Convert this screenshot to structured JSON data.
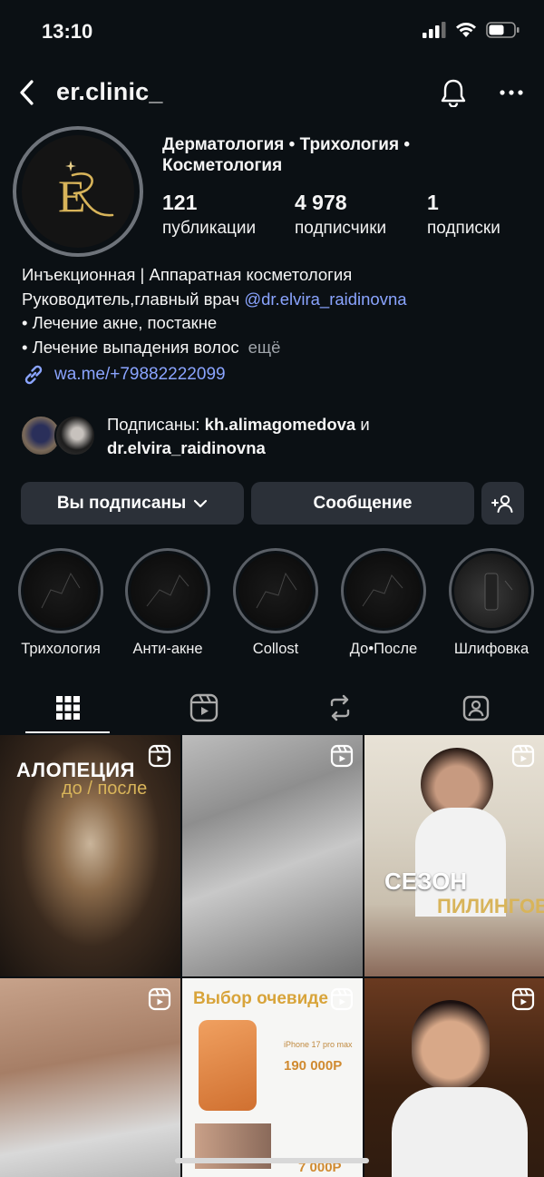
{
  "status_bar": {
    "time": "13:10"
  },
  "header": {
    "username": "er.clinic_"
  },
  "profile": {
    "category": "Дерматология • Трихология • Косметология",
    "stats": [
      {
        "value": "121",
        "label": "публикации"
      },
      {
        "value": "4 978",
        "label": "подписчики"
      },
      {
        "value": "1",
        "label": "подписки"
      }
    ],
    "bio": {
      "line1": "Инъекционная | Аппаратная косметология",
      "line2_prefix": "Руководитель,главный врач ",
      "line2_mention": "@dr.elvira_raidinovna",
      "line3": "• Лечение акне, постакне",
      "line4": "• Лечение выпадения волос",
      "more": "ещё"
    },
    "link": "wa.me/+79882222099",
    "followed_by": {
      "prefix": "Подписаны: ",
      "user1": "kh.alimagomedova",
      "conj": " и",
      "user2": "dr.elvira_raidinovna"
    }
  },
  "actions": {
    "following": "Вы подписаны",
    "message": "Сообщение"
  },
  "highlights": [
    {
      "label": "Трихология"
    },
    {
      "label": "Анти-акне"
    },
    {
      "label": "Collost"
    },
    {
      "label": "До•После"
    },
    {
      "label": "Шлифовка"
    }
  ],
  "posts": {
    "tile1_title": "АЛОПЕЦИЯ",
    "tile1_subtitle": "до / после",
    "tile3_title": "СЕЗОН",
    "tile3_subtitle": "ПИЛИНГОВ",
    "tile5_title": "Выбор очевиде",
    "tile5_model": "iPhone 17 pro max",
    "tile5_price": "190 000Р",
    "tile5_price2": "7 000Р"
  },
  "colors": {
    "background": "#0b1014",
    "button": "#2b3038",
    "link": "#8aa4ff",
    "gold": "#d8b45a"
  }
}
